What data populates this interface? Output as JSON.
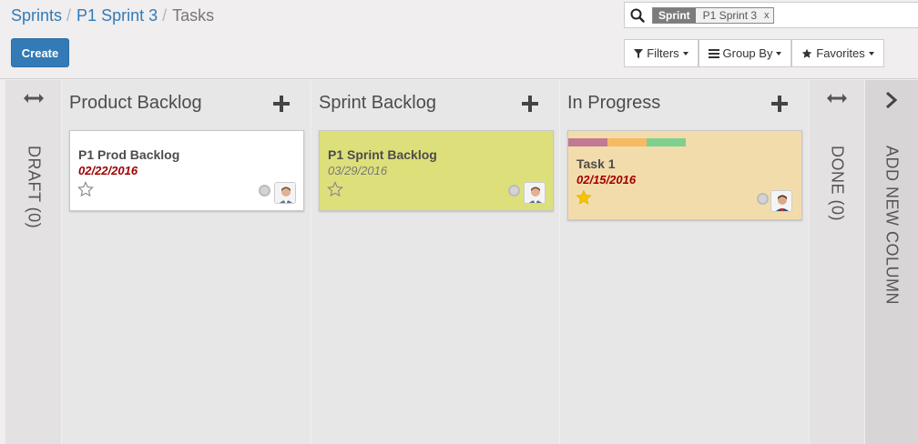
{
  "breadcrumb": {
    "root": "Sprints",
    "sep": "/",
    "sprint": "P1 Sprint 3",
    "current": "Tasks"
  },
  "toolbar": {
    "create_label": "Create"
  },
  "search": {
    "facet_label": "Sprint",
    "facet_value": "P1 Sprint 3",
    "facet_remove": "x",
    "placeholder": ""
  },
  "filters": {
    "filters_label": "Filters",
    "group_by_label": "Group By",
    "favorites_label": "Favorites"
  },
  "kanban": {
    "folded_draft": "DRAFT (0)",
    "folded_done": "DONE (0)",
    "add_new_column": "ADD NEW COLUMN",
    "columns": [
      {
        "title": "Product Backlog",
        "card": {
          "title": "P1 Prod Backlog",
          "date": "02/22/2016",
          "date_overdue": true,
          "starred": false,
          "color": "#ffffff"
        }
      },
      {
        "title": "Sprint Backlog",
        "card": {
          "title": "P1 Sprint Backlog",
          "date": "03/29/2016",
          "date_overdue": false,
          "starred": false,
          "color": "#dde07a"
        }
      },
      {
        "title": "In Progress",
        "card": {
          "title": "Task 1",
          "date": "02/15/2016",
          "date_overdue": true,
          "starred": true,
          "color": "#f3dcab",
          "tag_colors": [
            "#c17a91",
            "#f8b963",
            "#7ed08f"
          ]
        }
      }
    ]
  },
  "colors": {
    "accent": "#337ab7",
    "overdue": "#a00000",
    "star": "#f5c400"
  },
  "icons": [
    "search-icon",
    "filter-icon",
    "list-icon",
    "star-icon",
    "plus-icon",
    "fold-arrows-icon",
    "chevron-right-icon"
  ]
}
